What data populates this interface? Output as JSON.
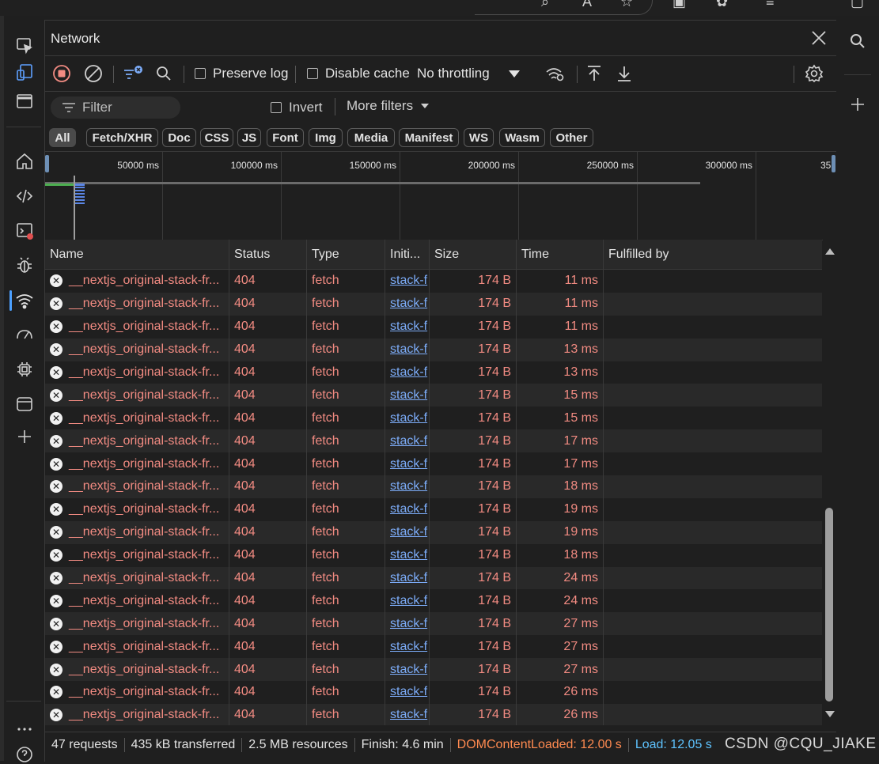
{
  "panel": {
    "title": "Network"
  },
  "toolbar": {
    "preserve_log": "Preserve log",
    "disable_cache": "Disable cache",
    "throttling": "No throttling"
  },
  "filter": {
    "placeholder": "Filter",
    "invert": "Invert",
    "more_filters": "More filters"
  },
  "type_filters": [
    "All",
    "Fetch/XHR",
    "Doc",
    "CSS",
    "JS",
    "Font",
    "Img",
    "Media",
    "Manifest",
    "WS",
    "Wasm",
    "Other"
  ],
  "overview": {
    "ticks": [
      "50000 ms",
      "100000 ms",
      "150000 ms",
      "200000 ms",
      "250000 ms",
      "300000 ms",
      "35"
    ]
  },
  "columns": [
    "Name",
    "Status",
    "Type",
    "Initi...",
    "Size",
    "Time",
    "Fulfilled by"
  ],
  "rows": [
    {
      "name": "__nextjs_original-stack-fr...",
      "status": "404",
      "type": "fetch",
      "initiator": "stack-f",
      "size": "174 B",
      "time": "11 ms",
      "fulfilled": ""
    },
    {
      "name": "__nextjs_original-stack-fr...",
      "status": "404",
      "type": "fetch",
      "initiator": "stack-f",
      "size": "174 B",
      "time": "11 ms",
      "fulfilled": ""
    },
    {
      "name": "__nextjs_original-stack-fr...",
      "status": "404",
      "type": "fetch",
      "initiator": "stack-f",
      "size": "174 B",
      "time": "11 ms",
      "fulfilled": ""
    },
    {
      "name": "__nextjs_original-stack-fr...",
      "status": "404",
      "type": "fetch",
      "initiator": "stack-f",
      "size": "174 B",
      "time": "13 ms",
      "fulfilled": ""
    },
    {
      "name": "__nextjs_original-stack-fr...",
      "status": "404",
      "type": "fetch",
      "initiator": "stack-f",
      "size": "174 B",
      "time": "13 ms",
      "fulfilled": ""
    },
    {
      "name": "__nextjs_original-stack-fr...",
      "status": "404",
      "type": "fetch",
      "initiator": "stack-f",
      "size": "174 B",
      "time": "15 ms",
      "fulfilled": ""
    },
    {
      "name": "__nextjs_original-stack-fr...",
      "status": "404",
      "type": "fetch",
      "initiator": "stack-f",
      "size": "174 B",
      "time": "15 ms",
      "fulfilled": ""
    },
    {
      "name": "__nextjs_original-stack-fr...",
      "status": "404",
      "type": "fetch",
      "initiator": "stack-f",
      "size": "174 B",
      "time": "17 ms",
      "fulfilled": ""
    },
    {
      "name": "__nextjs_original-stack-fr...",
      "status": "404",
      "type": "fetch",
      "initiator": "stack-f",
      "size": "174 B",
      "time": "17 ms",
      "fulfilled": ""
    },
    {
      "name": "__nextjs_original-stack-fr...",
      "status": "404",
      "type": "fetch",
      "initiator": "stack-f",
      "size": "174 B",
      "time": "18 ms",
      "fulfilled": ""
    },
    {
      "name": "__nextjs_original-stack-fr...",
      "status": "404",
      "type": "fetch",
      "initiator": "stack-f",
      "size": "174 B",
      "time": "19 ms",
      "fulfilled": ""
    },
    {
      "name": "__nextjs_original-stack-fr...",
      "status": "404",
      "type": "fetch",
      "initiator": "stack-f",
      "size": "174 B",
      "time": "19 ms",
      "fulfilled": ""
    },
    {
      "name": "__nextjs_original-stack-fr...",
      "status": "404",
      "type": "fetch",
      "initiator": "stack-f",
      "size": "174 B",
      "time": "18 ms",
      "fulfilled": ""
    },
    {
      "name": "__nextjs_original-stack-fr...",
      "status": "404",
      "type": "fetch",
      "initiator": "stack-f",
      "size": "174 B",
      "time": "24 ms",
      "fulfilled": ""
    },
    {
      "name": "__nextjs_original-stack-fr...",
      "status": "404",
      "type": "fetch",
      "initiator": "stack-f",
      "size": "174 B",
      "time": "24 ms",
      "fulfilled": ""
    },
    {
      "name": "__nextjs_original-stack-fr...",
      "status": "404",
      "type": "fetch",
      "initiator": "stack-f",
      "size": "174 B",
      "time": "27 ms",
      "fulfilled": ""
    },
    {
      "name": "__nextjs_original-stack-fr...",
      "status": "404",
      "type": "fetch",
      "initiator": "stack-f",
      "size": "174 B",
      "time": "27 ms",
      "fulfilled": ""
    },
    {
      "name": "__nextjs_original-stack-fr...",
      "status": "404",
      "type": "fetch",
      "initiator": "stack-f",
      "size": "174 B",
      "time": "27 ms",
      "fulfilled": ""
    },
    {
      "name": "__nextjs_original-stack-fr...",
      "status": "404",
      "type": "fetch",
      "initiator": "stack-f",
      "size": "174 B",
      "time": "26 ms",
      "fulfilled": ""
    },
    {
      "name": "__nextjs_original-stack-fr...",
      "status": "404",
      "type": "fetch",
      "initiator": "stack-f",
      "size": "174 B",
      "time": "26 ms",
      "fulfilled": ""
    }
  ],
  "status": {
    "requests": "47 requests",
    "transferred": "435 kB transferred",
    "resources": "2.5 MB resources",
    "finish": "Finish: 4.6 min",
    "dom_content_loaded": "DOMContentLoaded: 12.00 s",
    "load": "Load: 12.05 s"
  },
  "watermark": "CSDN @CQU_JIAKE",
  "colors": {
    "error_text": "#f28b82",
    "link": "#7cacf8",
    "dcl": "#ff8a50",
    "load": "#5ec3ff",
    "record_red": "#f28b82"
  }
}
